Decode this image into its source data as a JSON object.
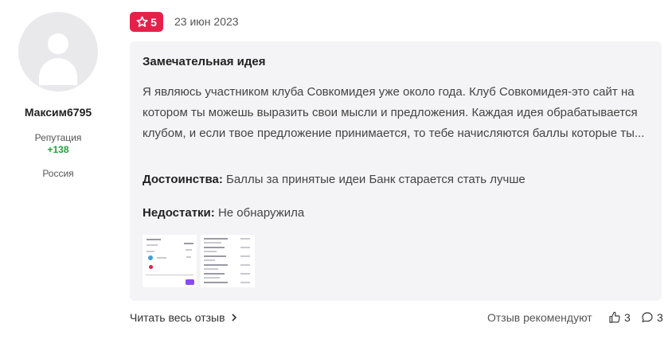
{
  "author": {
    "name": "Максим6795",
    "reputation_label": "Репутация",
    "reputation_value": "+138",
    "country": "Россия"
  },
  "review": {
    "rating": "5",
    "date": "23 июн 2023",
    "title": "Замечательная идея",
    "text": "Я являюсь участником клуба Совкомидея уже около года. Клуб Совкомидея-это сайт на котором ты можешь выразить свои мысли и предложения. Каждая идея обрабатывается клубом, и если твое предложение принимается, то тебе начисляются баллы которые ты...",
    "pros_label": "Достоинства:",
    "pros_text": "Баллы за принятые идеи Банк старается стать лучше",
    "cons_label": "Недостатки:",
    "cons_text": "Не обнаружила",
    "attachments": [
      "screenshot-thumbnail-1",
      "screenshot-thumbnail-2"
    ]
  },
  "footer": {
    "read_more": "Читать весь отзыв",
    "recommend": "Отзыв рекомендуют",
    "likes": "3",
    "comments": "3"
  },
  "icons": {
    "rating": "star-icon",
    "read_more": "chevron-right-icon",
    "likes": "thumbs-up-icon",
    "comments": "comment-bubble-icon"
  },
  "colors": {
    "rating_badge": "#e5214a",
    "reputation": "#22a03c",
    "card_background": "#f4f4f6"
  }
}
